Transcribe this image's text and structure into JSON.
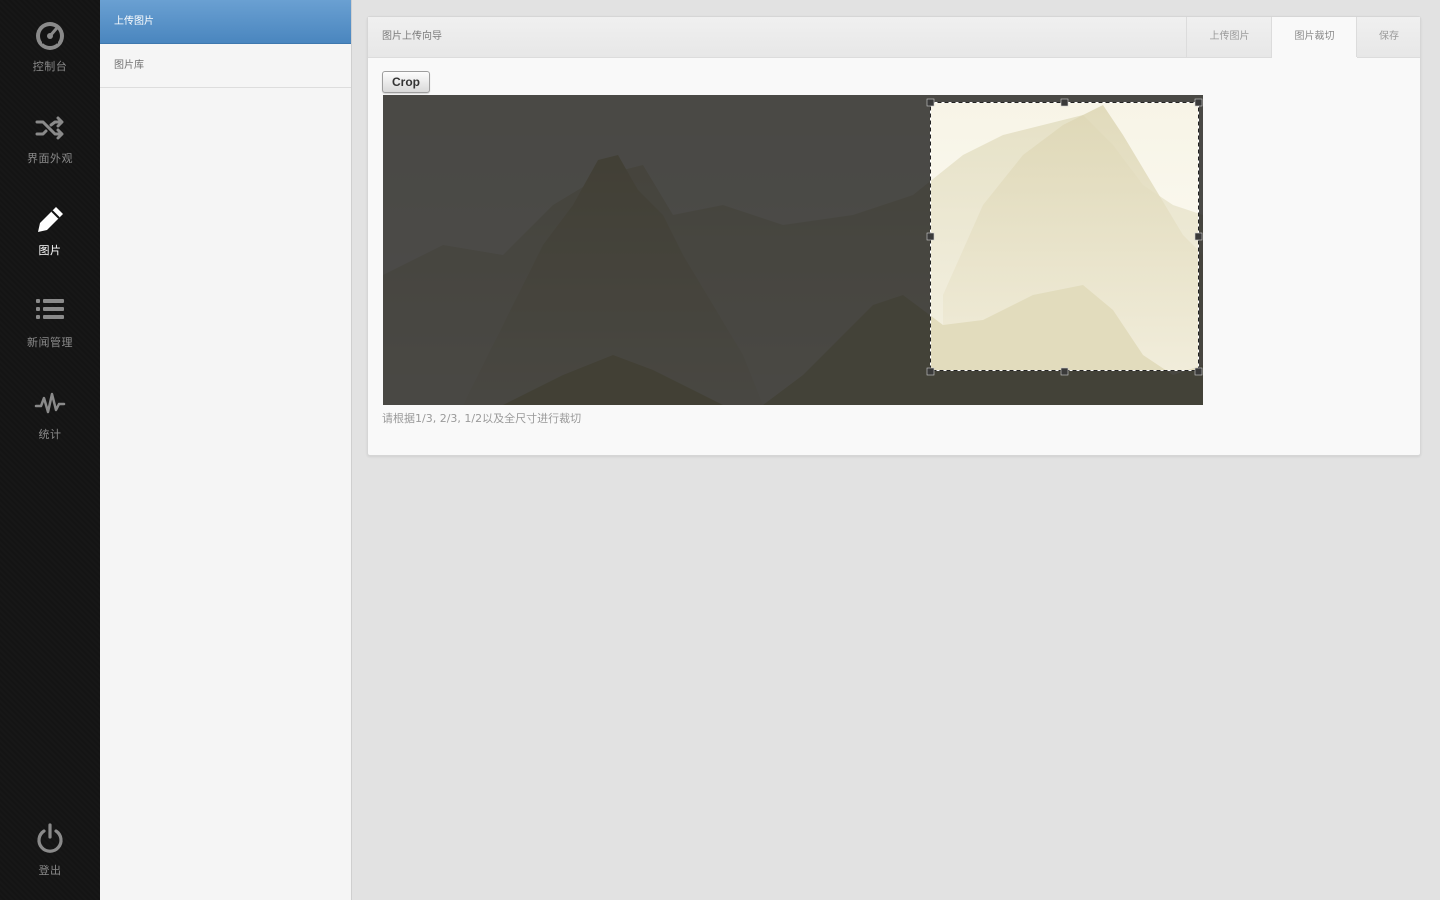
{
  "nav": {
    "items": [
      {
        "label": "控制台",
        "icon": "dashboard-icon",
        "active": false
      },
      {
        "label": "界面外观",
        "icon": "shuffle-icon",
        "active": false
      },
      {
        "label": "图片",
        "icon": "pencil-icon",
        "active": true
      },
      {
        "label": "新闻管理",
        "icon": "list-icon",
        "active": false
      },
      {
        "label": "统计",
        "icon": "pulse-icon",
        "active": false
      }
    ],
    "logout": {
      "label": "登出",
      "icon": "power-icon"
    }
  },
  "submenu": {
    "items": [
      {
        "label": "上传图片",
        "active": true
      },
      {
        "label": "图片库",
        "active": false
      }
    ]
  },
  "wizard": {
    "title": "图片上传向导",
    "steps": [
      {
        "label": "上传图片",
        "active": false
      },
      {
        "label": "图片裁切",
        "active": true
      },
      {
        "label": "保存",
        "active": false
      }
    ]
  },
  "cropper": {
    "button_label": "Crop",
    "hint": "请根据1/3, 2/3, 1/2以及全尺寸进行裁切"
  },
  "colors": {
    "accent": "#4a86bf",
    "nav_bg": "#141414",
    "image_tint": "#fbf8ea"
  }
}
